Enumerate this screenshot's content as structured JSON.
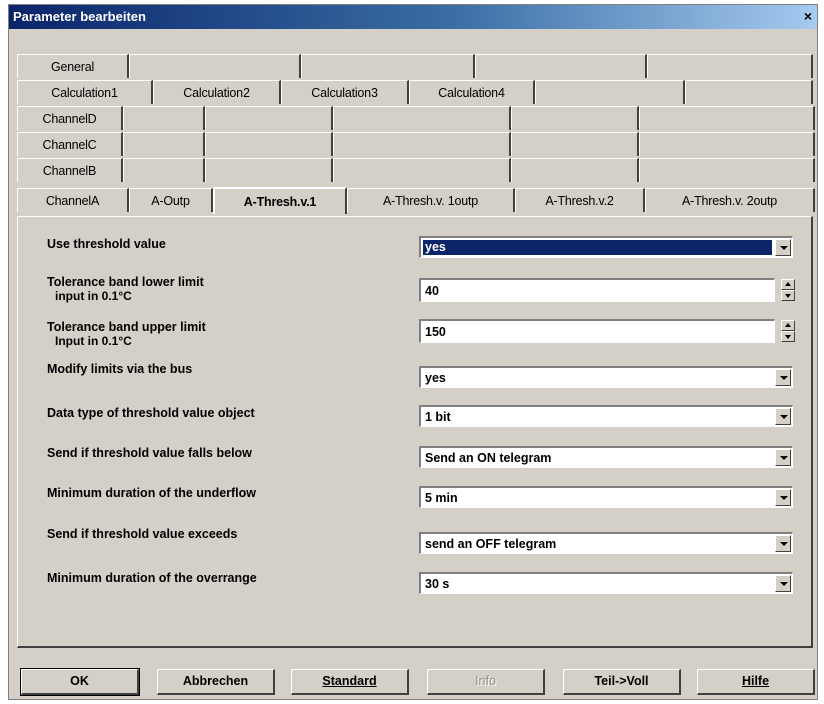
{
  "window": {
    "title": "Parameter bearbeiten",
    "close_glyph": "×"
  },
  "tabs": {
    "row1": [
      "General",
      "",
      "",
      "",
      ""
    ],
    "row2": [
      "Calculation1",
      "Calculation2",
      "Calculation3",
      "Calculation4",
      "",
      ""
    ],
    "row3": [
      "ChannelD",
      "",
      "",
      "",
      "",
      ""
    ],
    "row4": [
      "ChannelC",
      "",
      "",
      "",
      "",
      ""
    ],
    "row5": [
      "ChannelB",
      "",
      "",
      "",
      "",
      ""
    ],
    "row6": [
      "ChannelA",
      "A-Outp",
      "A-Thresh.v.1",
      "A-Thresh.v. 1outp",
      "A-Thresh.v.2",
      "A-Thresh.v. 2outp"
    ],
    "active": "A-Thresh.v.1"
  },
  "params": {
    "use_threshold": {
      "label": "Use threshold value",
      "value": "yes"
    },
    "lower_limit": {
      "label": "Tolerance band lower limit",
      "sublabel": "input in 0.1°C",
      "value": "40"
    },
    "upper_limit": {
      "label": "Tolerance band upper limit",
      "sublabel": "Input in 0.1°C",
      "value": "150"
    },
    "modify_limits": {
      "label": "Modify limits via the bus",
      "value": "yes"
    },
    "data_type": {
      "label": "Data type of threshold value object",
      "value": "1 bit"
    },
    "send_below": {
      "label": "Send if threshold value falls below",
      "value": "Send an ON telegram"
    },
    "min_underflow": {
      "label": "Minimum duration of the underflow",
      "value": "5 min"
    },
    "send_exceeds": {
      "label": "Send if threshold value exceeds",
      "value": "send an OFF telegram"
    },
    "min_overrange": {
      "label": "Minimum duration of the overrange",
      "value": "30 s"
    }
  },
  "buttons": {
    "ok": "OK",
    "cancel": "Abbrechen",
    "standard": "Standard",
    "info": "Info",
    "partial_full": "Teil->Voll",
    "help": "Hilfe"
  },
  "colors": {
    "titlebar_start": "#0a246a",
    "dialog_face": "#d4d0c8",
    "selection": "#0a246a"
  }
}
